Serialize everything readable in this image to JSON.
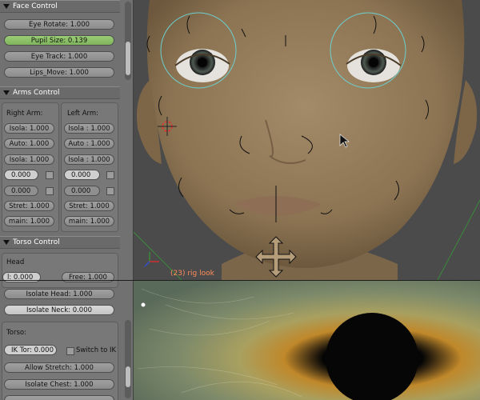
{
  "face_control": {
    "title": "Face Control",
    "eye_rotate": "Eye Rotate: 1.000",
    "pupil_size": "Pupil Size: 0.139",
    "eye_track": "Eye Track: 1.000",
    "lips_move": "Lips_Move: 1.000"
  },
  "arms_control": {
    "title": "Arms Control",
    "right_arm": {
      "label": "Right Arm:",
      "isola1": "Isola: 1.000",
      "auto": "Auto: 1.000",
      "isola2": "Isola: 1.000",
      "value1": "0.000",
      "value2": "0.000",
      "stret": "Stret: 1.000",
      "main": "main: 1.000"
    },
    "left_arm": {
      "label": "Left Arm:",
      "isola1": "Isola : 1.000",
      "auto": "Auto : 1.000",
      "isola2": "Isola : 1.000",
      "value1": "0.000",
      "value2": "0.000",
      "stret": "Stret: 1.000",
      "main": "main: 1.000"
    }
  },
  "torso_control": {
    "title": "Torso Control",
    "head_label": "Head",
    "head_value": "l: 0.000",
    "free": "Free: 1.000",
    "isolate_head": "Isolate Head: 1.000",
    "isolate_neck": "Isolate Neck: 0.000",
    "torso_label": "Torso:",
    "ik_tor": "IK Tor: 0.000",
    "switch_to_ik": "Switch to IK",
    "allow_stretch": "Allow Stretch: 1.000",
    "isolate_chest": "Isolate Chest: 1.000"
  },
  "viewport": {
    "object_label": "(23) rig look"
  },
  "icons": [
    "collapse-triangle-icon",
    "checkbox-icon",
    "cursor-arrow-icon",
    "3d-cursor-icon",
    "move-arrows-icon",
    "axis-gizmo-icon"
  ]
}
